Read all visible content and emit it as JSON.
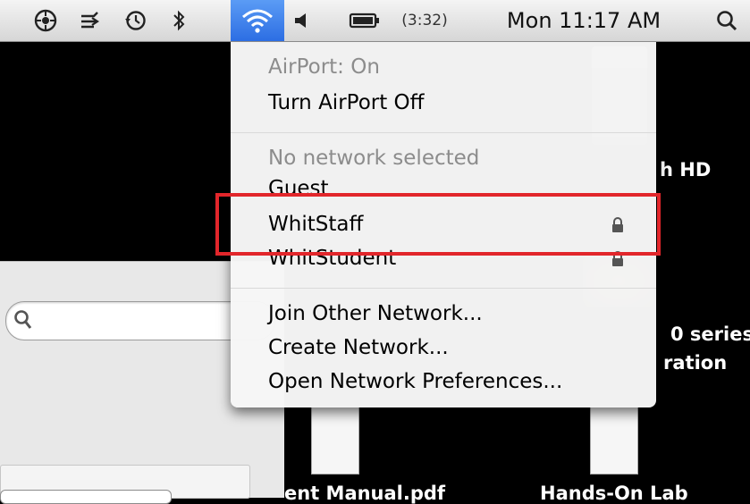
{
  "menubar": {
    "icons": [
      "scripts-icon",
      "sync-icon",
      "time-machine-icon",
      "bluetooth-icon",
      "wifi-icon",
      "volume-icon",
      "battery-icon",
      "spotlight-icon"
    ],
    "battery_time": "(3:32)",
    "clock": "Mon 11:17 AM"
  },
  "airport_menu": {
    "status": "AirPort: On",
    "toggle_label": "Turn AirPort Off",
    "no_network": "No network selected",
    "networks": [
      {
        "name": "Guest",
        "locked": false
      },
      {
        "name": "WhitStaff",
        "locked": true
      },
      {
        "name": "WhitStudent",
        "locked": true
      }
    ],
    "actions": [
      "Join Other Network...",
      "Create Network...",
      "Open Network Preferences..."
    ]
  },
  "desktop": {
    "hd_label_fragment": "h HD",
    "printer_label_line1": "0 series",
    "printer_label_line2": "ration",
    "doc1_label": "ent Manual.pdf",
    "doc2_label": "Hands-On Lab"
  },
  "colors": {
    "highlight_box": "#e2262b",
    "wifi_selected": "#2c6ee3"
  }
}
